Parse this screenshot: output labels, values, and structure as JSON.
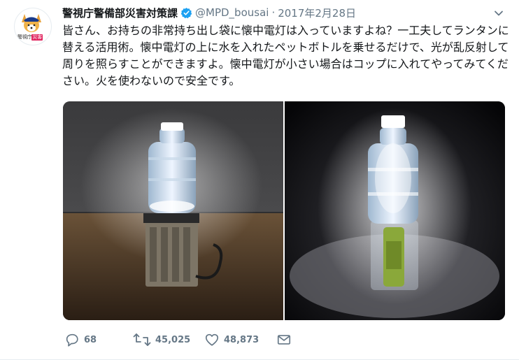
{
  "tweet": {
    "display_name": "警視庁警備部災害対策課",
    "handle": "@MPD_bousai",
    "separator": "·",
    "date": "2017年2月28日",
    "text": "皆さん、お持ちの非常持ち出し袋に懐中電灯は入っていますよね？一工夫してランタンに替える活用術。懐中電灯の上に水を入れたペットボトルを乗せるだけで、光が乱反射して周りを照らすことができますよ。懐中電灯が小さい場合はコップに入れてやってみてください。火を使わないので安全です。",
    "avatar_caption": "警視庁",
    "avatar_tag": "災害"
  },
  "actions": {
    "reply_count": "68",
    "retweet_count": "45,025",
    "like_count": "48,873"
  },
  "icons": {
    "verified": "verified-badge-icon",
    "caret": "chevron-down-icon",
    "reply": "reply-icon",
    "retweet": "retweet-icon",
    "like": "heart-icon",
    "dm": "envelope-icon"
  },
  "colors": {
    "text": "#14171a",
    "secondary": "#657786",
    "verified": "#1da1f2",
    "border": "#e6ecf0"
  }
}
